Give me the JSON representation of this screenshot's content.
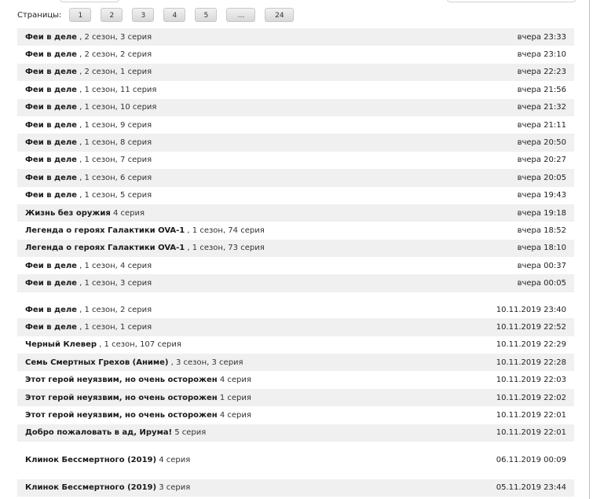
{
  "pagination": {
    "label": "Страницы:",
    "pages": [
      "1",
      "2",
      "3",
      "4",
      "5",
      "...",
      "24"
    ]
  },
  "groups": [
    [
      {
        "title": "Феи в деле",
        "rest": " , 2 сезон, 3 серия",
        "time": "вчера 23:33"
      },
      {
        "title": "Феи в деле",
        "rest": " , 2 сезон, 2 серия",
        "time": "вчера 23:10"
      },
      {
        "title": "Феи в деле",
        "rest": " , 2 сезон, 1 серия",
        "time": "вчера 22:23"
      },
      {
        "title": "Феи в деле",
        "rest": " , 1 сезон, 11 серия",
        "time": "вчера 21:56"
      },
      {
        "title": "Феи в деле",
        "rest": " , 1 сезон, 10 серия",
        "time": "вчера 21:32"
      },
      {
        "title": "Феи в деле",
        "rest": " , 1 сезон, 9 серия",
        "time": "вчера 21:11"
      },
      {
        "title": "Феи в деле",
        "rest": " , 1 сезон, 8 серия",
        "time": "вчера 20:50"
      },
      {
        "title": "Феи в деле",
        "rest": " , 1 сезон, 7 серия",
        "time": "вчера 20:27"
      },
      {
        "title": "Феи в деле",
        "rest": " , 1 сезон, 6 серия",
        "time": "вчера 20:05"
      },
      {
        "title": "Феи в деле",
        "rest": " , 1 сезон, 5 серия",
        "time": "вчера 19:43"
      },
      {
        "title": "Жизнь без оружия",
        "rest": " 4 серия",
        "time": "вчера 19:18"
      },
      {
        "title": "Легенда о героях Галактики OVA-1",
        "rest": " , 1 сезон, 74 серия",
        "time": "вчера 18:52"
      },
      {
        "title": "Легенда о героях Галактики OVA-1",
        "rest": " , 1 сезон, 73 серия",
        "time": "вчера 18:10"
      },
      {
        "title": "Феи в деле",
        "rest": " , 1 сезон, 4 серия",
        "time": "вчера 00:37"
      },
      {
        "title": "Феи в деле",
        "rest": " , 1 сезон, 3 серия",
        "time": "вчера 00:05"
      }
    ],
    [
      {
        "title": "Феи в деле",
        "rest": " , 1 сезон, 2 серия",
        "time": "10.11.2019 23:40"
      },
      {
        "title": "Феи в деле",
        "rest": " , 1 сезон, 1 серия",
        "time": "10.11.2019 22:52"
      },
      {
        "title": "Черный Клевер",
        "rest": " , 1 сезон, 107 серия",
        "time": "10.11.2019 22:29"
      },
      {
        "title": "Семь Смертных Грехов (Аниме)",
        "rest": " , 3 сезон, 3 серия",
        "time": "10.11.2019 22:28"
      },
      {
        "title": "Этот герой неуязвим, но очень осторожен",
        "rest": " 4 серия",
        "time": "10.11.2019 22:03"
      },
      {
        "title": "Этот герой неуязвим, но очень осторожен",
        "rest": " 1 серия",
        "time": "10.11.2019 22:02"
      },
      {
        "title": "Этот герой неуязвим, но очень осторожен",
        "rest": " 4 серия",
        "time": "10.11.2019 22:01"
      },
      {
        "title": "Добро пожаловать в ад, Ирума!",
        "rest": " 5 серия",
        "time": "10.11.2019 22:01"
      }
    ],
    [
      {
        "title": "Клинок Бессмертного (2019)",
        "rest": " 4 серия",
        "time": "06.11.2019 00:09"
      }
    ],
    [
      {
        "title": "Клинок Бессмертного (2019)",
        "rest": " 3 серия",
        "time": "05.11.2019 23:44"
      }
    ]
  ]
}
